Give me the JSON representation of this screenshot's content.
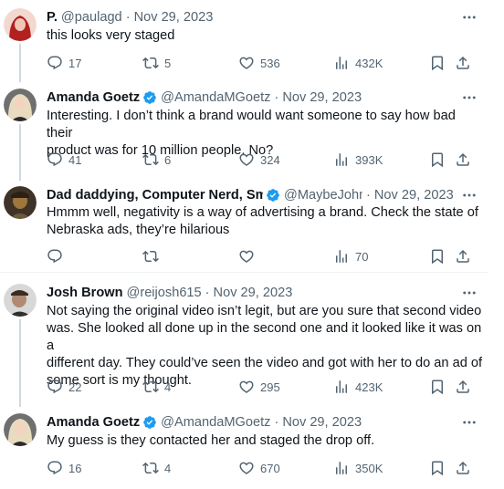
{
  "tweets": [
    {
      "display_name": "P.",
      "handle": "@paulagd",
      "date": "Nov 29, 2023",
      "verified": false,
      "text": [
        "this looks very staged"
      ],
      "reply_count": "17",
      "retweet_count": "5",
      "like_count": "536",
      "view_count": "432K",
      "avatar_color": "#c0392b"
    },
    {
      "display_name": "Amanda Goetz",
      "handle": "@AmandaMGoetz",
      "date": "Nov 29, 2023",
      "verified": true,
      "text": [
        "Interesting. I don’t think a brand would want someone to say how bad their",
        "product was for 10 million people. No?"
      ],
      "reply_count": "41",
      "retweet_count": "6",
      "like_count": "324",
      "view_count": "393K",
      "avatar_color": "#d9c7a7"
    },
    {
      "display_name": "Dad daddying, Computer Nerd, Smar",
      "handle": "@MaybeJohn",
      "date": "Nov 29, 2023",
      "verified": true,
      "text": [
        "Hmmm well, negativity is a way of advertising a brand. Check the state of",
        "Nebraska ads, they’re hilarious"
      ],
      "reply_count": "",
      "retweet_count": "",
      "like_count": "",
      "view_count": "70",
      "avatar_color": "#5a4632"
    },
    {
      "display_name": "Josh Brown",
      "handle": "@reijosh615",
      "date": "Nov 29, 2023",
      "verified": false,
      "text": [
        "Not saying the original video isn’t legit, but are you sure that second video",
        "was. She looked all done up in the second one and it looked like it was on a",
        "different day. They could’ve seen the video and got with her to do an ad of",
        "some sort is my thought."
      ],
      "reply_count": "22",
      "retweet_count": "4",
      "like_count": "295",
      "view_count": "423K",
      "avatar_color": "#4a4a4a"
    },
    {
      "display_name": "Amanda Goetz",
      "handle": "@AmandaMGoetz",
      "date": "Nov 29, 2023",
      "verified": true,
      "text": [
        "My guess is they contacted her and staged the drop off."
      ],
      "reply_count": "16",
      "retweet_count": "4",
      "like_count": "670",
      "view_count": "350K",
      "avatar_color": "#d9c7a7"
    }
  ],
  "separator": "·",
  "colors": {
    "text": "#0f1419",
    "secondary": "#536471",
    "verified": "#1d9bf0",
    "divider": "#eff3f4",
    "thread_line": "#cfd9de"
  },
  "icons": {
    "reply": "reply-icon",
    "retweet": "retweet-icon",
    "like": "heart-icon",
    "views": "views-icon",
    "bookmark": "bookmark-icon",
    "share": "share-icon",
    "more": "more-icon",
    "verified": "verified-badge-icon"
  }
}
